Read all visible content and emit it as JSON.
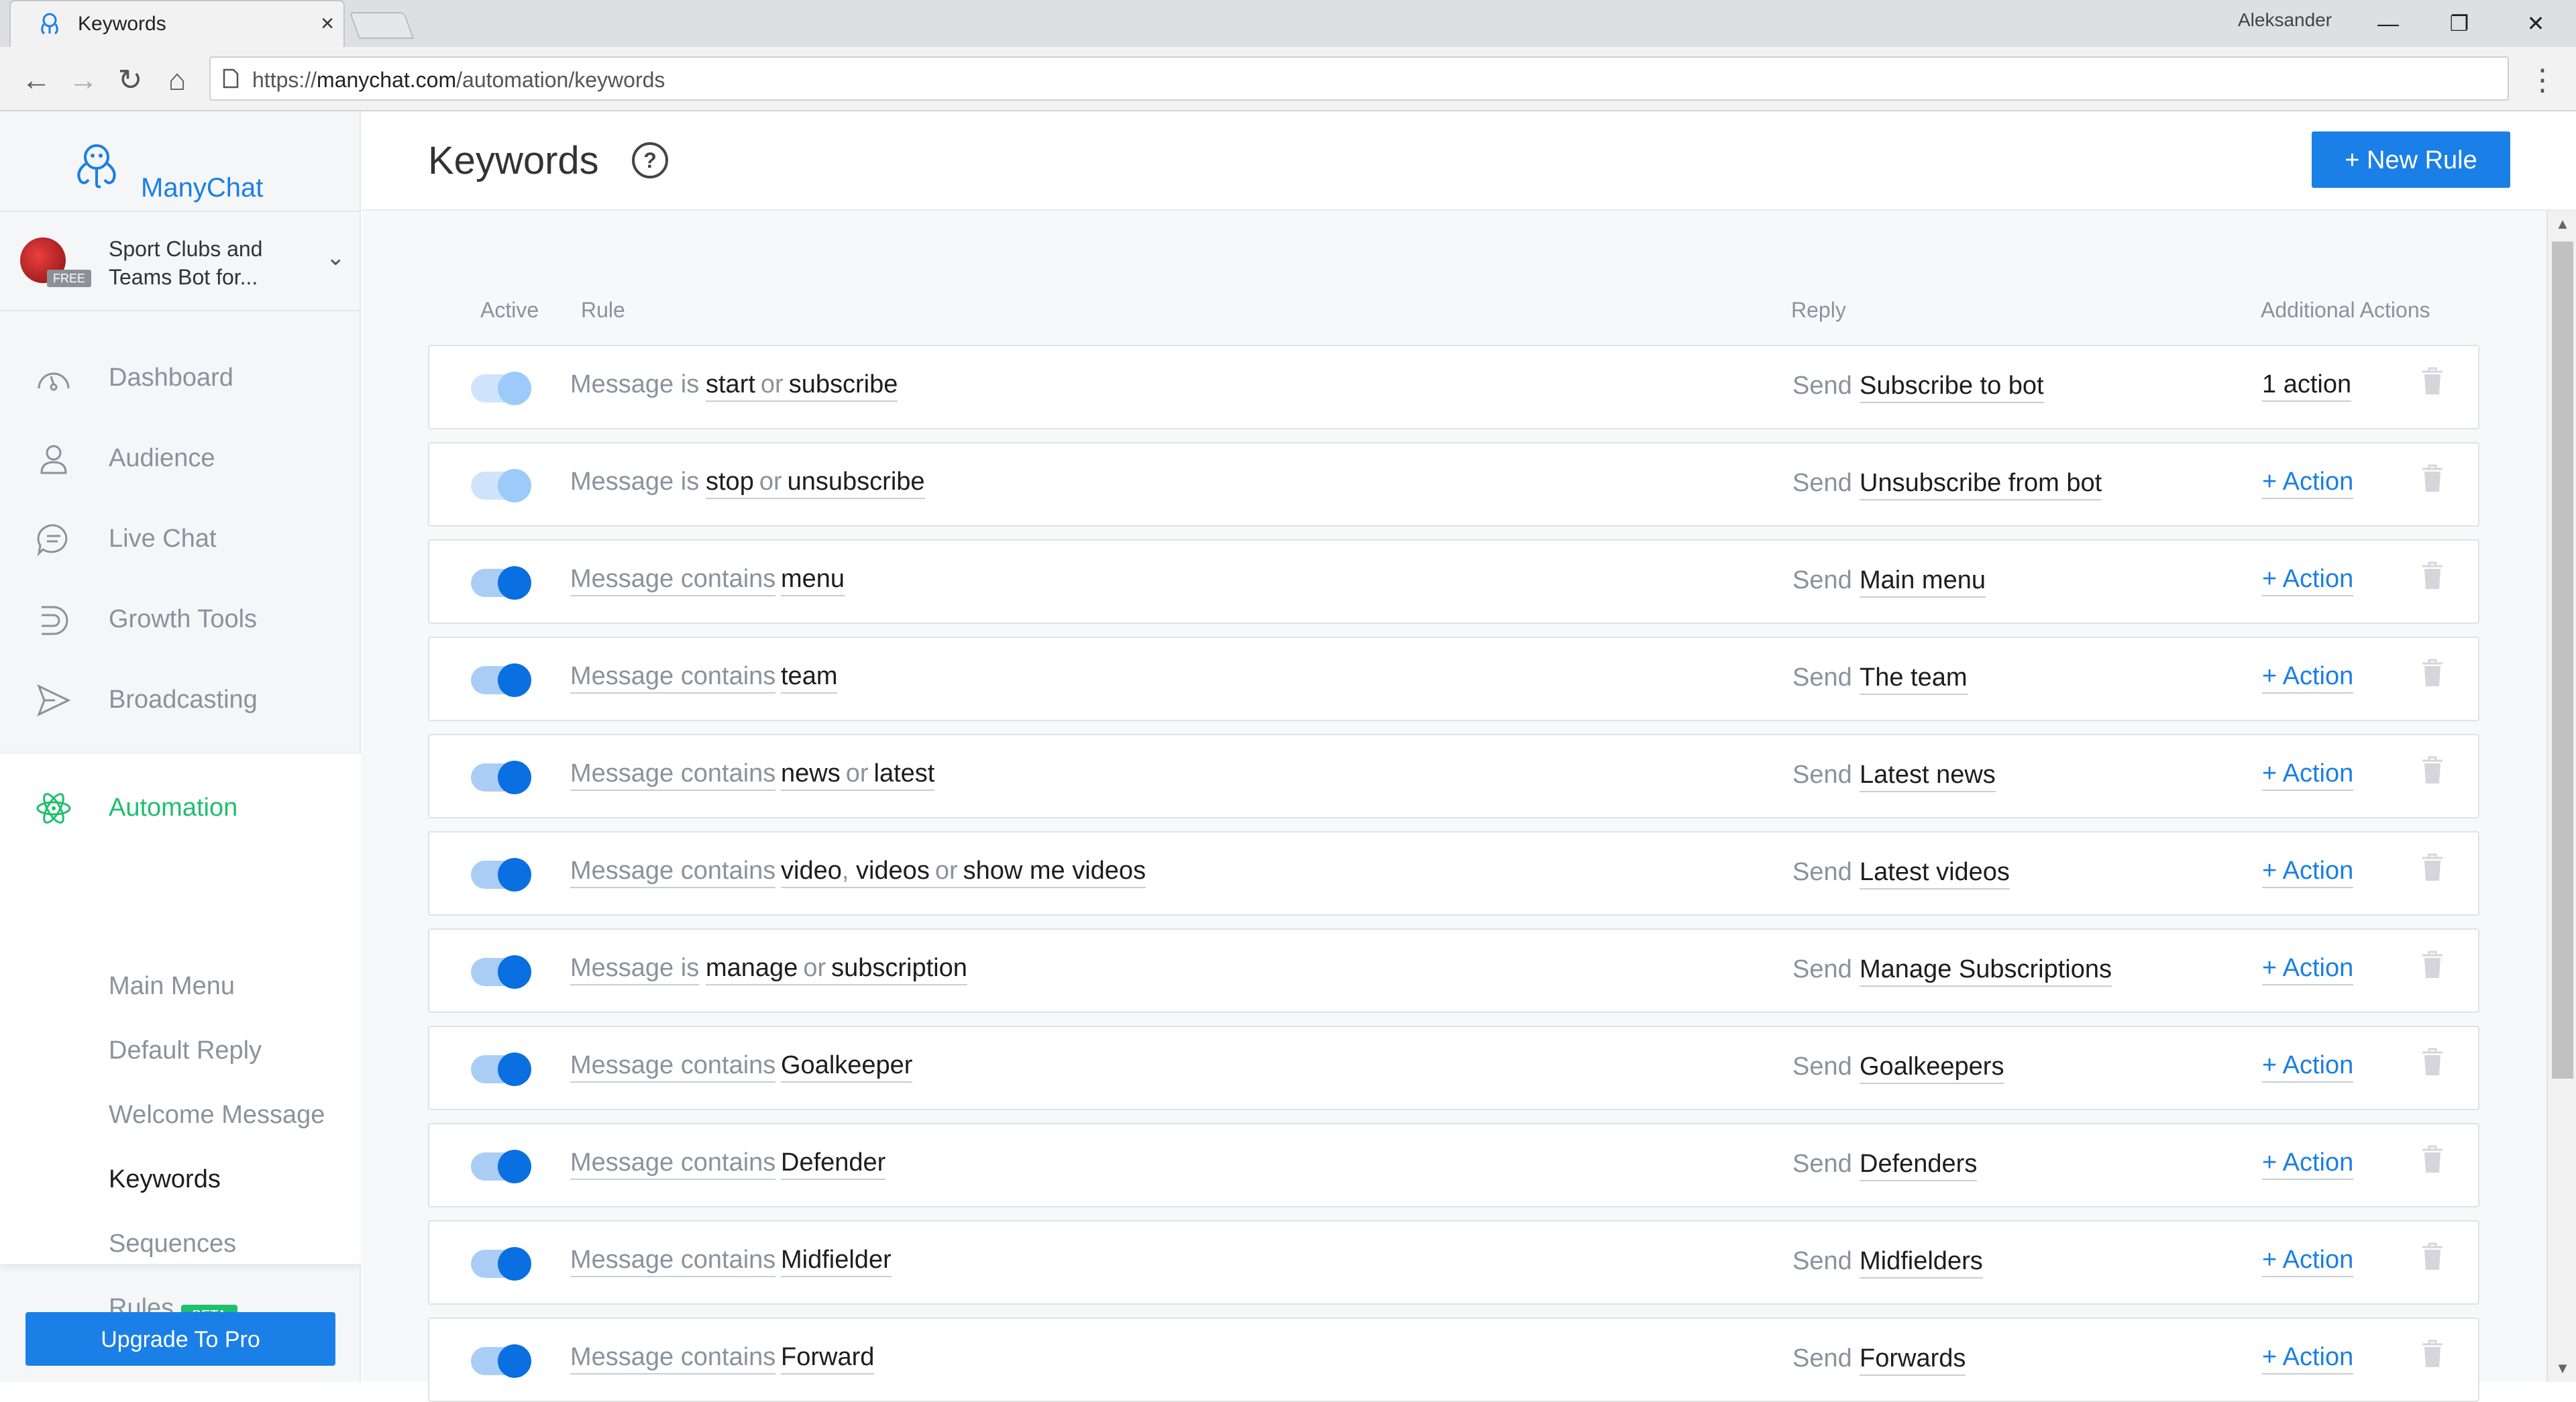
{
  "browser": {
    "tab_title": "Keywords",
    "tab_close": "×",
    "user": "Aleksander",
    "url_prefix": "https://",
    "url_domain": "manychat.com",
    "url_path": "/automation/keywords",
    "minimize": "—",
    "restore": "❐",
    "close": "✕",
    "menu": "⋮",
    "back": "←",
    "forward": "→",
    "reload": "↻",
    "home": "⌂"
  },
  "sidebar": {
    "brand": "ManyChat",
    "page_name": "Sport Clubs and Teams Bot for...",
    "plan_badge": "FREE",
    "chevron": "⌄",
    "nav": [
      {
        "label": "Dashboard",
        "icon": "dashboard-icon"
      },
      {
        "label": "Audience",
        "icon": "audience-icon"
      },
      {
        "label": "Live Chat",
        "icon": "live-chat-icon"
      },
      {
        "label": "Growth Tools",
        "icon": "growth-tools-icon"
      },
      {
        "label": "Broadcasting",
        "icon": "broadcasting-icon"
      }
    ],
    "automation": {
      "label": "Automation",
      "icon": "automation-icon",
      "items": [
        "Main Menu",
        "Default Reply",
        "Welcome Message",
        "Keywords",
        "Sequences",
        "Rules"
      ],
      "current": "Keywords",
      "rules_badge": "BETA"
    },
    "upgrade_label": "Upgrade To Pro"
  },
  "header": {
    "title": "Keywords",
    "help": "?",
    "new_rule_label": "+ New Rule"
  },
  "table": {
    "headers": {
      "active": "Active",
      "rule": "Rule",
      "reply": "Reply",
      "additional_actions": "Additional Actions"
    },
    "send_label": "Send",
    "or_label": "or",
    "rows": [
      {
        "active": "dim",
        "condition": "Message is",
        "keywords": [
          "start",
          "subscribe"
        ],
        "reply": "Subscribe to bot",
        "action": "1 action"
      },
      {
        "active": "dim",
        "condition": "Message is",
        "keywords": [
          "stop",
          "unsubscribe"
        ],
        "reply": "Unsubscribe from bot",
        "action": "+ Action"
      },
      {
        "active": "on",
        "condition": "Message contains",
        "keywords": [
          "menu"
        ],
        "reply": "Main menu",
        "action": "+ Action"
      },
      {
        "active": "on",
        "condition": "Message contains",
        "keywords": [
          "team"
        ],
        "reply": "The team",
        "action": "+ Action"
      },
      {
        "active": "on",
        "condition": "Message contains",
        "keywords": [
          "news",
          "latest"
        ],
        "reply": "Latest news",
        "action": "+ Action"
      },
      {
        "active": "on",
        "condition": "Message contains",
        "keywords": [
          "video",
          "videos",
          "show me videos"
        ],
        "reply": "Latest videos",
        "action": "+ Action"
      },
      {
        "active": "on",
        "condition": "Message is",
        "keywords": [
          "manage",
          "subscription"
        ],
        "reply": "Manage Subscriptions",
        "action": "+ Action"
      },
      {
        "active": "on",
        "condition": "Message contains",
        "keywords": [
          "Goalkeeper"
        ],
        "reply": "Goalkeepers",
        "action": "+ Action"
      },
      {
        "active": "on",
        "condition": "Message contains",
        "keywords": [
          "Defender"
        ],
        "reply": "Defenders",
        "action": "+ Action"
      },
      {
        "active": "on",
        "condition": "Message contains",
        "keywords": [
          "Midfielder"
        ],
        "reply": "Midfielders",
        "action": "+ Action"
      },
      {
        "active": "on",
        "condition": "Message contains",
        "keywords": [
          "Forward"
        ],
        "reply": "Forwards",
        "action": "+ Action"
      }
    ]
  },
  "colors": {
    "accent": "#1a7fe6",
    "automation_green": "#1fbf6c",
    "muted_text": "#8a929c"
  }
}
